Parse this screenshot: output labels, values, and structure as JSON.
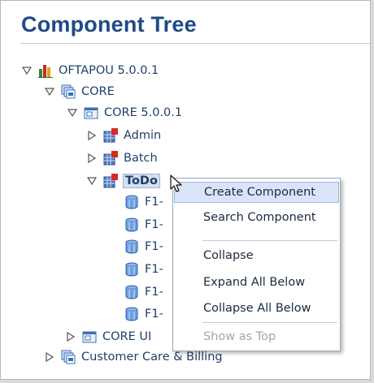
{
  "panel": {
    "title": "Component Tree"
  },
  "tree": {
    "root": {
      "label": "OFTAPOU 5.0.0.1",
      "expanded": true
    },
    "core": {
      "label": "CORE",
      "expanded": true
    },
    "core_version": {
      "label": "CORE 5.0.0.1",
      "expanded": true
    },
    "admin": {
      "label": "Admin",
      "expanded": false
    },
    "batch": {
      "label": "Batch",
      "expanded": false
    },
    "todo": {
      "label": "ToDo",
      "expanded": true,
      "selected": true
    },
    "todo_children": [
      "F1-",
      "F1-",
      "F1-",
      "F1-",
      "F1-",
      "F1-"
    ],
    "core_ui": {
      "label": "CORE UI",
      "expanded": false
    },
    "customer_care": {
      "label": "Customer Care & Billing",
      "expanded": false
    }
  },
  "context_menu": {
    "create": "Create Component",
    "search": "Search Component",
    "collapse": "Collapse",
    "expand_all": "Expand All Below",
    "collapse_all": "Collapse All Below",
    "show_as_top": "Show as Top"
  },
  "colors": {
    "title": "#1f4a86",
    "tree_text": "#1f3f6b",
    "menu_highlight": "#d9e5f6",
    "disabled": "#a0a6ae"
  }
}
